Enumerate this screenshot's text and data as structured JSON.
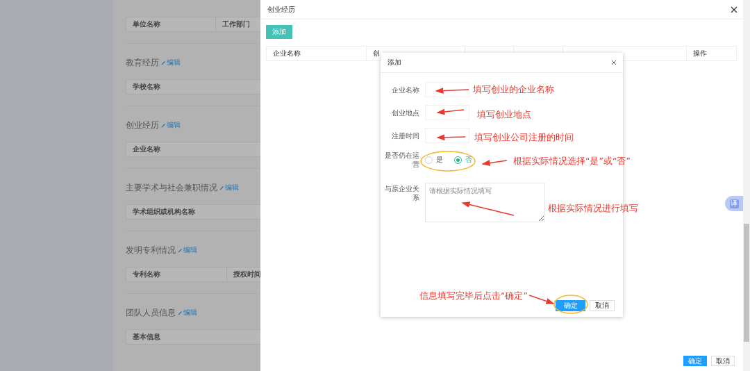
{
  "background_page": {
    "sections": [
      {
        "columns": [
          "单位名称",
          "工作部门"
        ]
      },
      {
        "title": "教育经历",
        "edit": "编辑",
        "columns": [
          "学校名称"
        ]
      },
      {
        "title": "创业经历",
        "edit": "编辑",
        "columns": [
          "企业名称"
        ]
      },
      {
        "title": "主要学术与社会兼职情况",
        "edit": "编辑",
        "columns": [
          "学术组织或机构名称"
        ]
      },
      {
        "title": "发明专利情况",
        "edit": "编辑",
        "columns": [
          "专利名称",
          "授权时间"
        ]
      },
      {
        "title": "团队人员信息",
        "edit": "编辑",
        "columns": [
          "基本信息"
        ]
      }
    ]
  },
  "drawer": {
    "title": "创业经历",
    "add_button": "添加",
    "table": {
      "columns": [
        "企业名称",
        "创",
        "操作"
      ]
    },
    "buttons": [
      {
        "label": "确定",
        "kind": "primary"
      },
      {
        "label": "取消",
        "kind": "default"
      }
    ]
  },
  "dialog": {
    "title": "添加",
    "fields": [
      {
        "kind": "text",
        "label": "企业名称"
      },
      {
        "kind": "text",
        "label": "创业地点"
      },
      {
        "kind": "text",
        "label": "注册时间"
      },
      {
        "kind": "radio",
        "label": "是否仍在运营",
        "options": [
          {
            "label": "是",
            "selected": false
          },
          {
            "label": "否",
            "selected": true
          }
        ]
      },
      {
        "kind": "textarea",
        "label": "与原企业关系",
        "placeholder": "请根据实际情况填写"
      }
    ],
    "buttons": [
      {
        "label": "确定",
        "kind": "primary"
      },
      {
        "label": "取消",
        "kind": "default"
      }
    ]
  },
  "annotations": [
    {
      "text": "填写创业的企业名称"
    },
    {
      "text": "填写创业地点"
    },
    {
      "text": "填写创业公司注册的时间"
    },
    {
      "text": "根据实际情况选择“是”或“否”"
    },
    {
      "text": "根据实际情况进行填写"
    },
    {
      "text": "信息填写完毕后点击“确定”"
    }
  ],
  "translate_badge": {
    "label": "译"
  }
}
